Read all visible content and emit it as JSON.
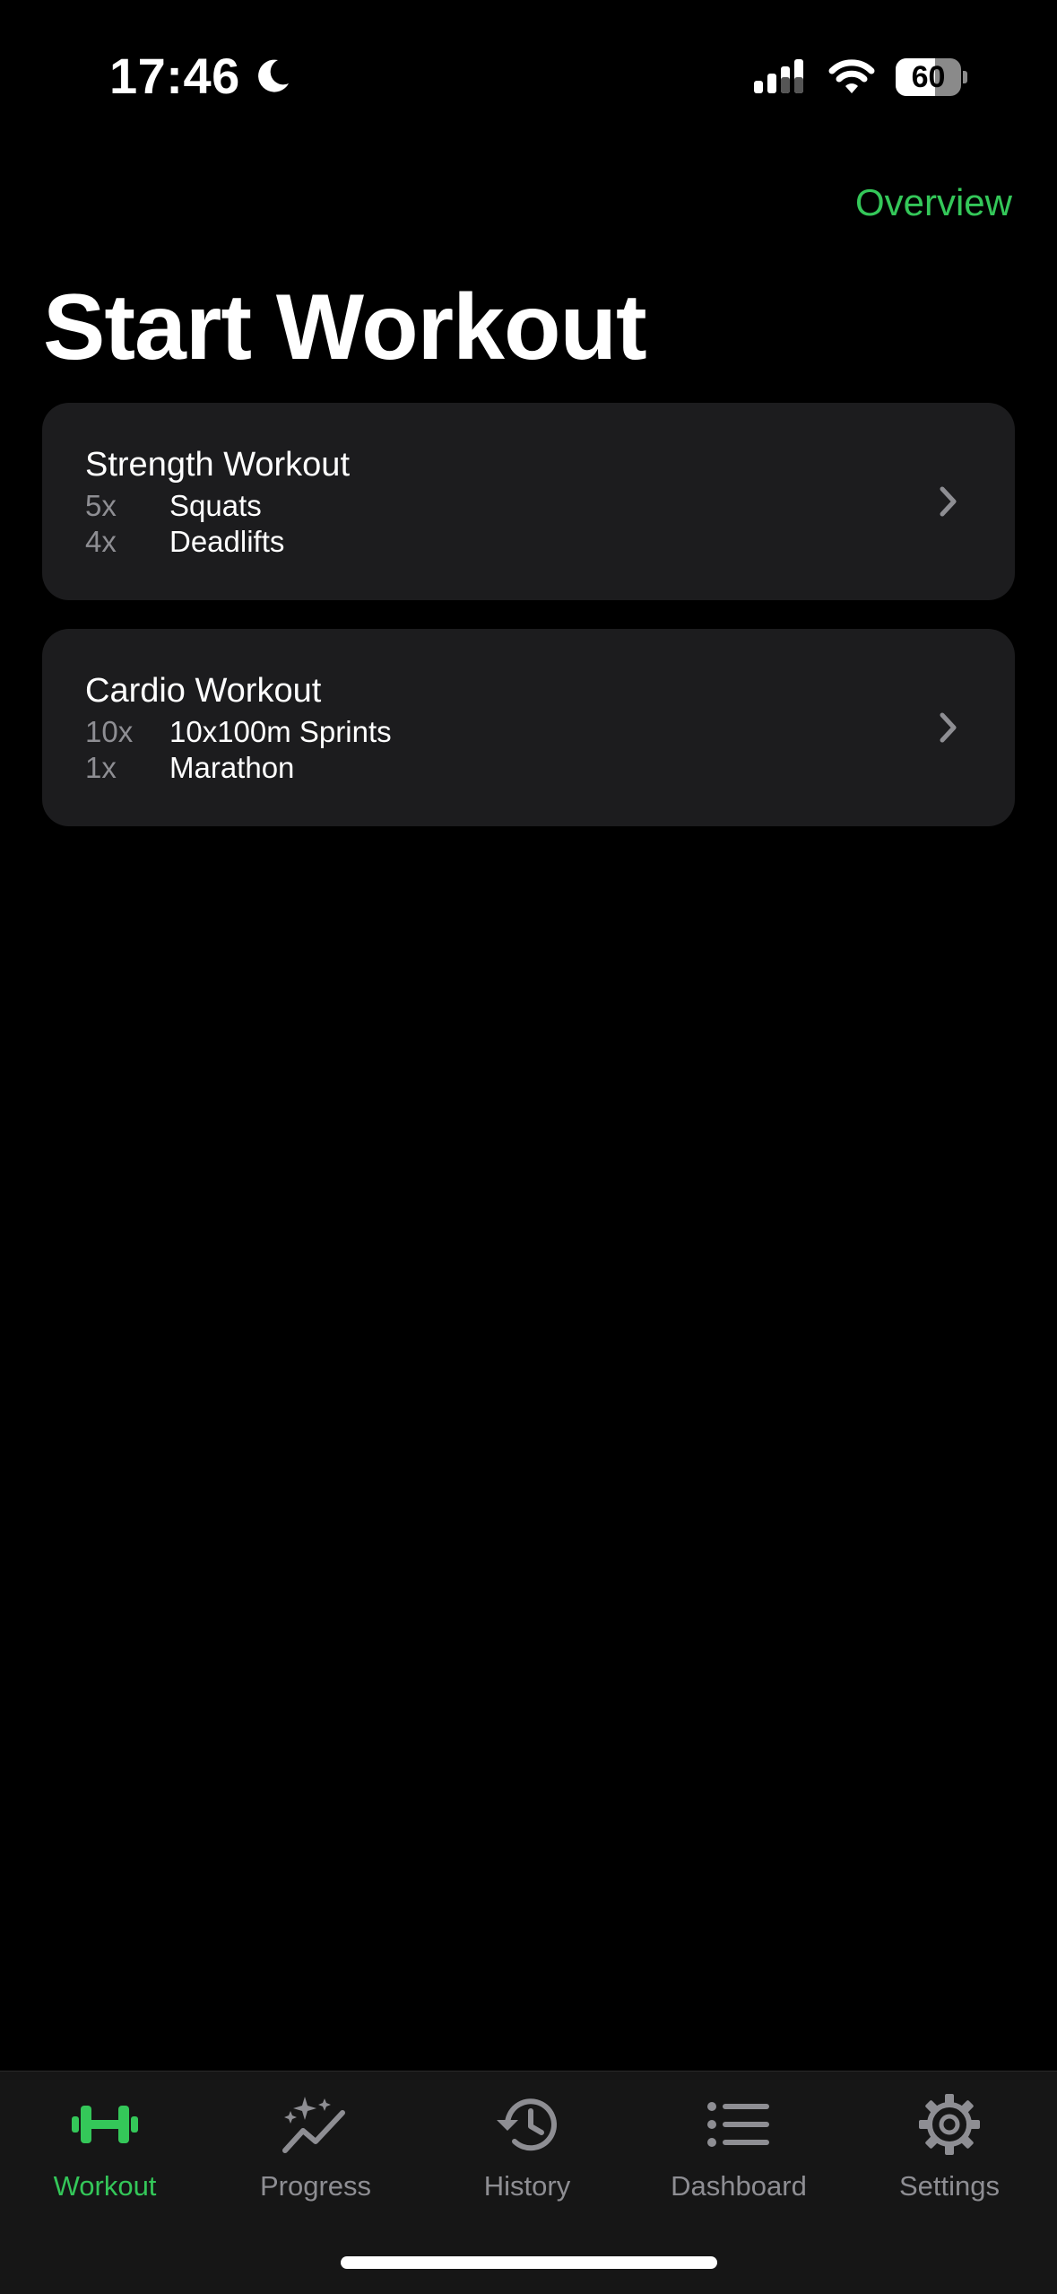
{
  "status_bar": {
    "time": "17:46",
    "battery": "60",
    "battery_level": 0.6,
    "icons": [
      "moon-icon",
      "signal-icon",
      "wifi-icon",
      "battery-icon"
    ]
  },
  "header": {
    "overview_label": "Overview",
    "title": "Start Workout"
  },
  "workouts": [
    {
      "title": "Strength Workout",
      "exercises": [
        {
          "count": "5x",
          "name": "Squats"
        },
        {
          "count": "4x",
          "name": "Deadlifts"
        }
      ]
    },
    {
      "title": "Cardio Workout",
      "exercises": [
        {
          "count": "10x",
          "name": "10x100m Sprints"
        },
        {
          "count": "1x",
          "name": "Marathon"
        }
      ]
    }
  ],
  "tabs": [
    {
      "label": "Workout",
      "icon": "dumbbell-icon",
      "active": true
    },
    {
      "label": "Progress",
      "icon": "sparkle-chart-icon",
      "active": false
    },
    {
      "label": "History",
      "icon": "history-clock-icon",
      "active": false
    },
    {
      "label": "Dashboard",
      "icon": "list-icon",
      "active": false
    },
    {
      "label": "Settings",
      "icon": "gear-icon",
      "active": false
    }
  ],
  "colors": {
    "accent": "#34c759",
    "background": "#000000",
    "card": "#1c1c1e",
    "secondary_text": "#8e8e93",
    "tab_bar": "#161616"
  }
}
